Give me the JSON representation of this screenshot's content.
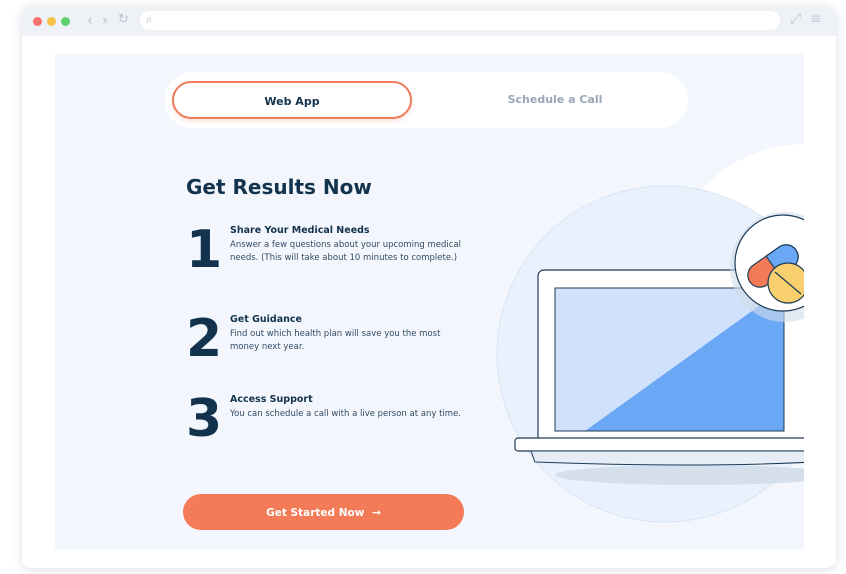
{
  "tabs": [
    {
      "label": "Web App",
      "active": true
    },
    {
      "label": "Schedule a Call",
      "active": false
    }
  ],
  "heading": "Get Results Now",
  "steps": [
    {
      "number": "1",
      "title": "Share Your Medical Needs",
      "description": "Answer a few questions about your upcoming medical needs.  (This will take about 10 minutes to complete.)"
    },
    {
      "number": "2",
      "title": "Get Guidance",
      "description": "Find out which health plan will save you the most money next year."
    },
    {
      "number": "3",
      "title": "Access Support",
      "description": "You can schedule a call with a live person at any time."
    }
  ],
  "cta": {
    "label": "Get Started Now",
    "arrow": "→"
  },
  "colors": {
    "accent": "#f47b58",
    "navy": "#12324d",
    "background": "#f3f7fd",
    "illustration_blue": "#6aa7f5"
  },
  "icons": [
    "search-icon",
    "back-icon",
    "forward-icon",
    "reload-icon",
    "expand-icon",
    "menu-icon",
    "pill-icon",
    "tablet-icon",
    "laptop-illustration"
  ]
}
